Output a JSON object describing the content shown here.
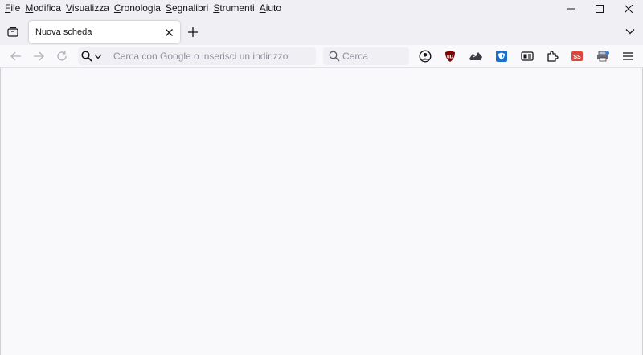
{
  "menubar": {
    "items": [
      {
        "accel": "F",
        "rest": "ile"
      },
      {
        "accel": "M",
        "rest": "odifica"
      },
      {
        "accel": "V",
        "rest": "isualizza"
      },
      {
        "accel": "C",
        "rest": "ronologia"
      },
      {
        "accel": "S",
        "rest": "egnalibri"
      },
      {
        "accel": "S",
        "rest": "trumenti"
      },
      {
        "accel": "A",
        "rest": "iuto"
      }
    ]
  },
  "tabs": [
    {
      "title": "Nuova scheda",
      "active": true
    }
  ],
  "navbar": {
    "url_placeholder": "Cerca con Google o inserisci un indirizzo",
    "search_placeholder": "Cerca"
  },
  "extensions": [
    {
      "icon": "account-icon"
    },
    {
      "icon": "ublock-origin-icon",
      "label": "uD",
      "color": "#800000"
    },
    {
      "icon": "sneaker-extension-icon"
    },
    {
      "icon": "shield-extension-icon",
      "color": "#1a6fc9"
    },
    {
      "icon": "reader-card-icon"
    },
    {
      "icon": "puzzle-extensions-icon"
    },
    {
      "icon": "ss-extension-icon",
      "label": "SS",
      "color": "#e0453a"
    },
    {
      "icon": "printer-extension-icon"
    },
    {
      "icon": "hamburger-menu-icon"
    }
  ],
  "colors": {
    "chrome_bg": "#f0f0f4",
    "toolbar_bg": "#f9f9fb",
    "content_bg": "#f9f9fb"
  }
}
